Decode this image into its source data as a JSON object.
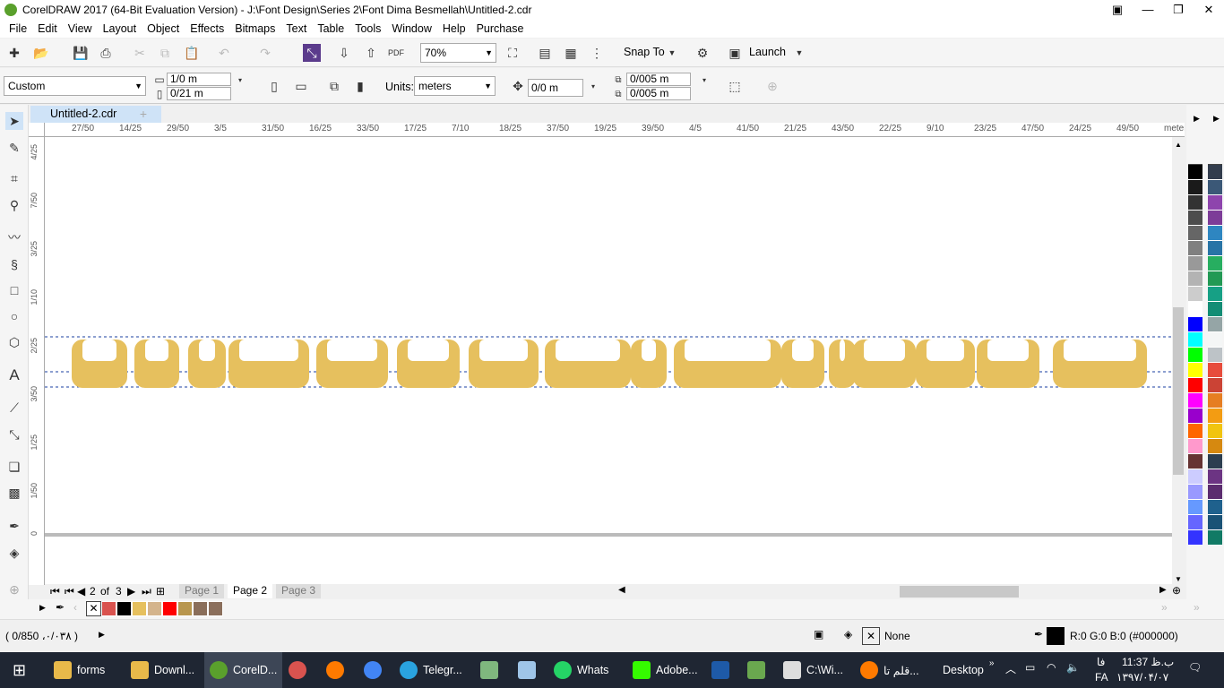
{
  "window": {
    "title": "CorelDRAW 2017 (64-Bit Evaluation Version) - J:\\Font Design\\Series 2\\Font Dima Besmellah\\Untitled-2.cdr"
  },
  "menu": [
    "File",
    "Edit",
    "View",
    "Layout",
    "Object",
    "Effects",
    "Bitmaps",
    "Text",
    "Table",
    "Tools",
    "Window",
    "Help",
    "Purchase"
  ],
  "toolbar": {
    "zoom": "70%",
    "snap_label": "Snap To",
    "launch_label": "Launch"
  },
  "property_bar": {
    "page_size": "Custom",
    "width": "1/0 m",
    "height": "0/21 m",
    "units_label": "Units:",
    "units": "meters",
    "nudge": "0/0 m",
    "dup_x": "0/005 m",
    "dup_y": "0/005 m"
  },
  "doc_tab": "Untitled-2.cdr",
  "ruler_h": [
    "27/50",
    "14/25",
    "29/50",
    "3/5",
    "31/50",
    "16/25",
    "33/50",
    "17/25",
    "7/10",
    "18/25",
    "37/50",
    "19/25",
    "39/50",
    "4/5",
    "41/50",
    "21/25",
    "43/50",
    "22/25",
    "9/10",
    "23/25",
    "47/50",
    "24/25",
    "49/50",
    "meters"
  ],
  "ruler_v": [
    "4/25",
    "7/50",
    "3/25",
    "1/10",
    "2/25",
    "3/50",
    "1/25",
    "1/50",
    "0"
  ],
  "pages": {
    "current": "2",
    "of_label": "of",
    "total": "3",
    "tabs": [
      "Page 1",
      "Page 2",
      "Page 3"
    ]
  },
  "palette_left": [
    "#000000",
    "#1a1a1a",
    "#333333",
    "#4d4d4d",
    "#666666",
    "#808080",
    "#999999",
    "#b3b3b3",
    "#cccccc",
    "#ffffff",
    "#0000ff",
    "#00ffff",
    "#00ff00",
    "#ffff00",
    "#ff0000",
    "#ff00ff",
    "#9900cc",
    "#ff6600",
    "#ff99cc",
    "#663333",
    "#ccccff",
    "#9999ff",
    "#6699ff",
    "#6666ff",
    "#3333ff"
  ],
  "palette_right": [
    "#333d4d",
    "#3b5877",
    "#8e44ad",
    "#7d3c98",
    "#2e86c1",
    "#2874a6",
    "#27ae60",
    "#229954",
    "#16a085",
    "#138d75",
    "#95a5a6",
    "#f4f6f6",
    "#bdc3c7",
    "#e74c3c",
    "#cb4335",
    "#e67e22",
    "#f39c12",
    "#f1c40f",
    "#d68910",
    "#2c3e50",
    "#6c3483",
    "#5b2c6f",
    "#1f618d",
    "#1a5276",
    "#117a65"
  ],
  "doc_palette": [
    "#d9534f",
    "#000000",
    "#e6c05e",
    "#d4b48c",
    "#ff0000",
    "#b8964e",
    "#8a6e5a",
    "#8b6f5c"
  ],
  "status": {
    "coords": "( 0/850 ،۰/۰۳۸ )",
    "fill_label": "None",
    "outline_label": "R:0 G:0 B:0 (#000000)",
    "fill_color": "#ffffff",
    "outline_color": "#000000"
  },
  "taskbar": {
    "items": [
      "forms",
      "Downl...",
      "CorelD...",
      "",
      "",
      "",
      "Telegr...",
      "",
      "",
      "Whats",
      "Adobe...",
      "",
      "",
      "C:\\Wi...",
      "قلم تا...",
      "Desktop"
    ],
    "time": "11:37 ب.ظ",
    "date": "۱۳۹۷/۰۴/۰۷",
    "lang": "FA",
    "lang2": "فا"
  },
  "artwork": {
    "color": "#e6c05e"
  }
}
